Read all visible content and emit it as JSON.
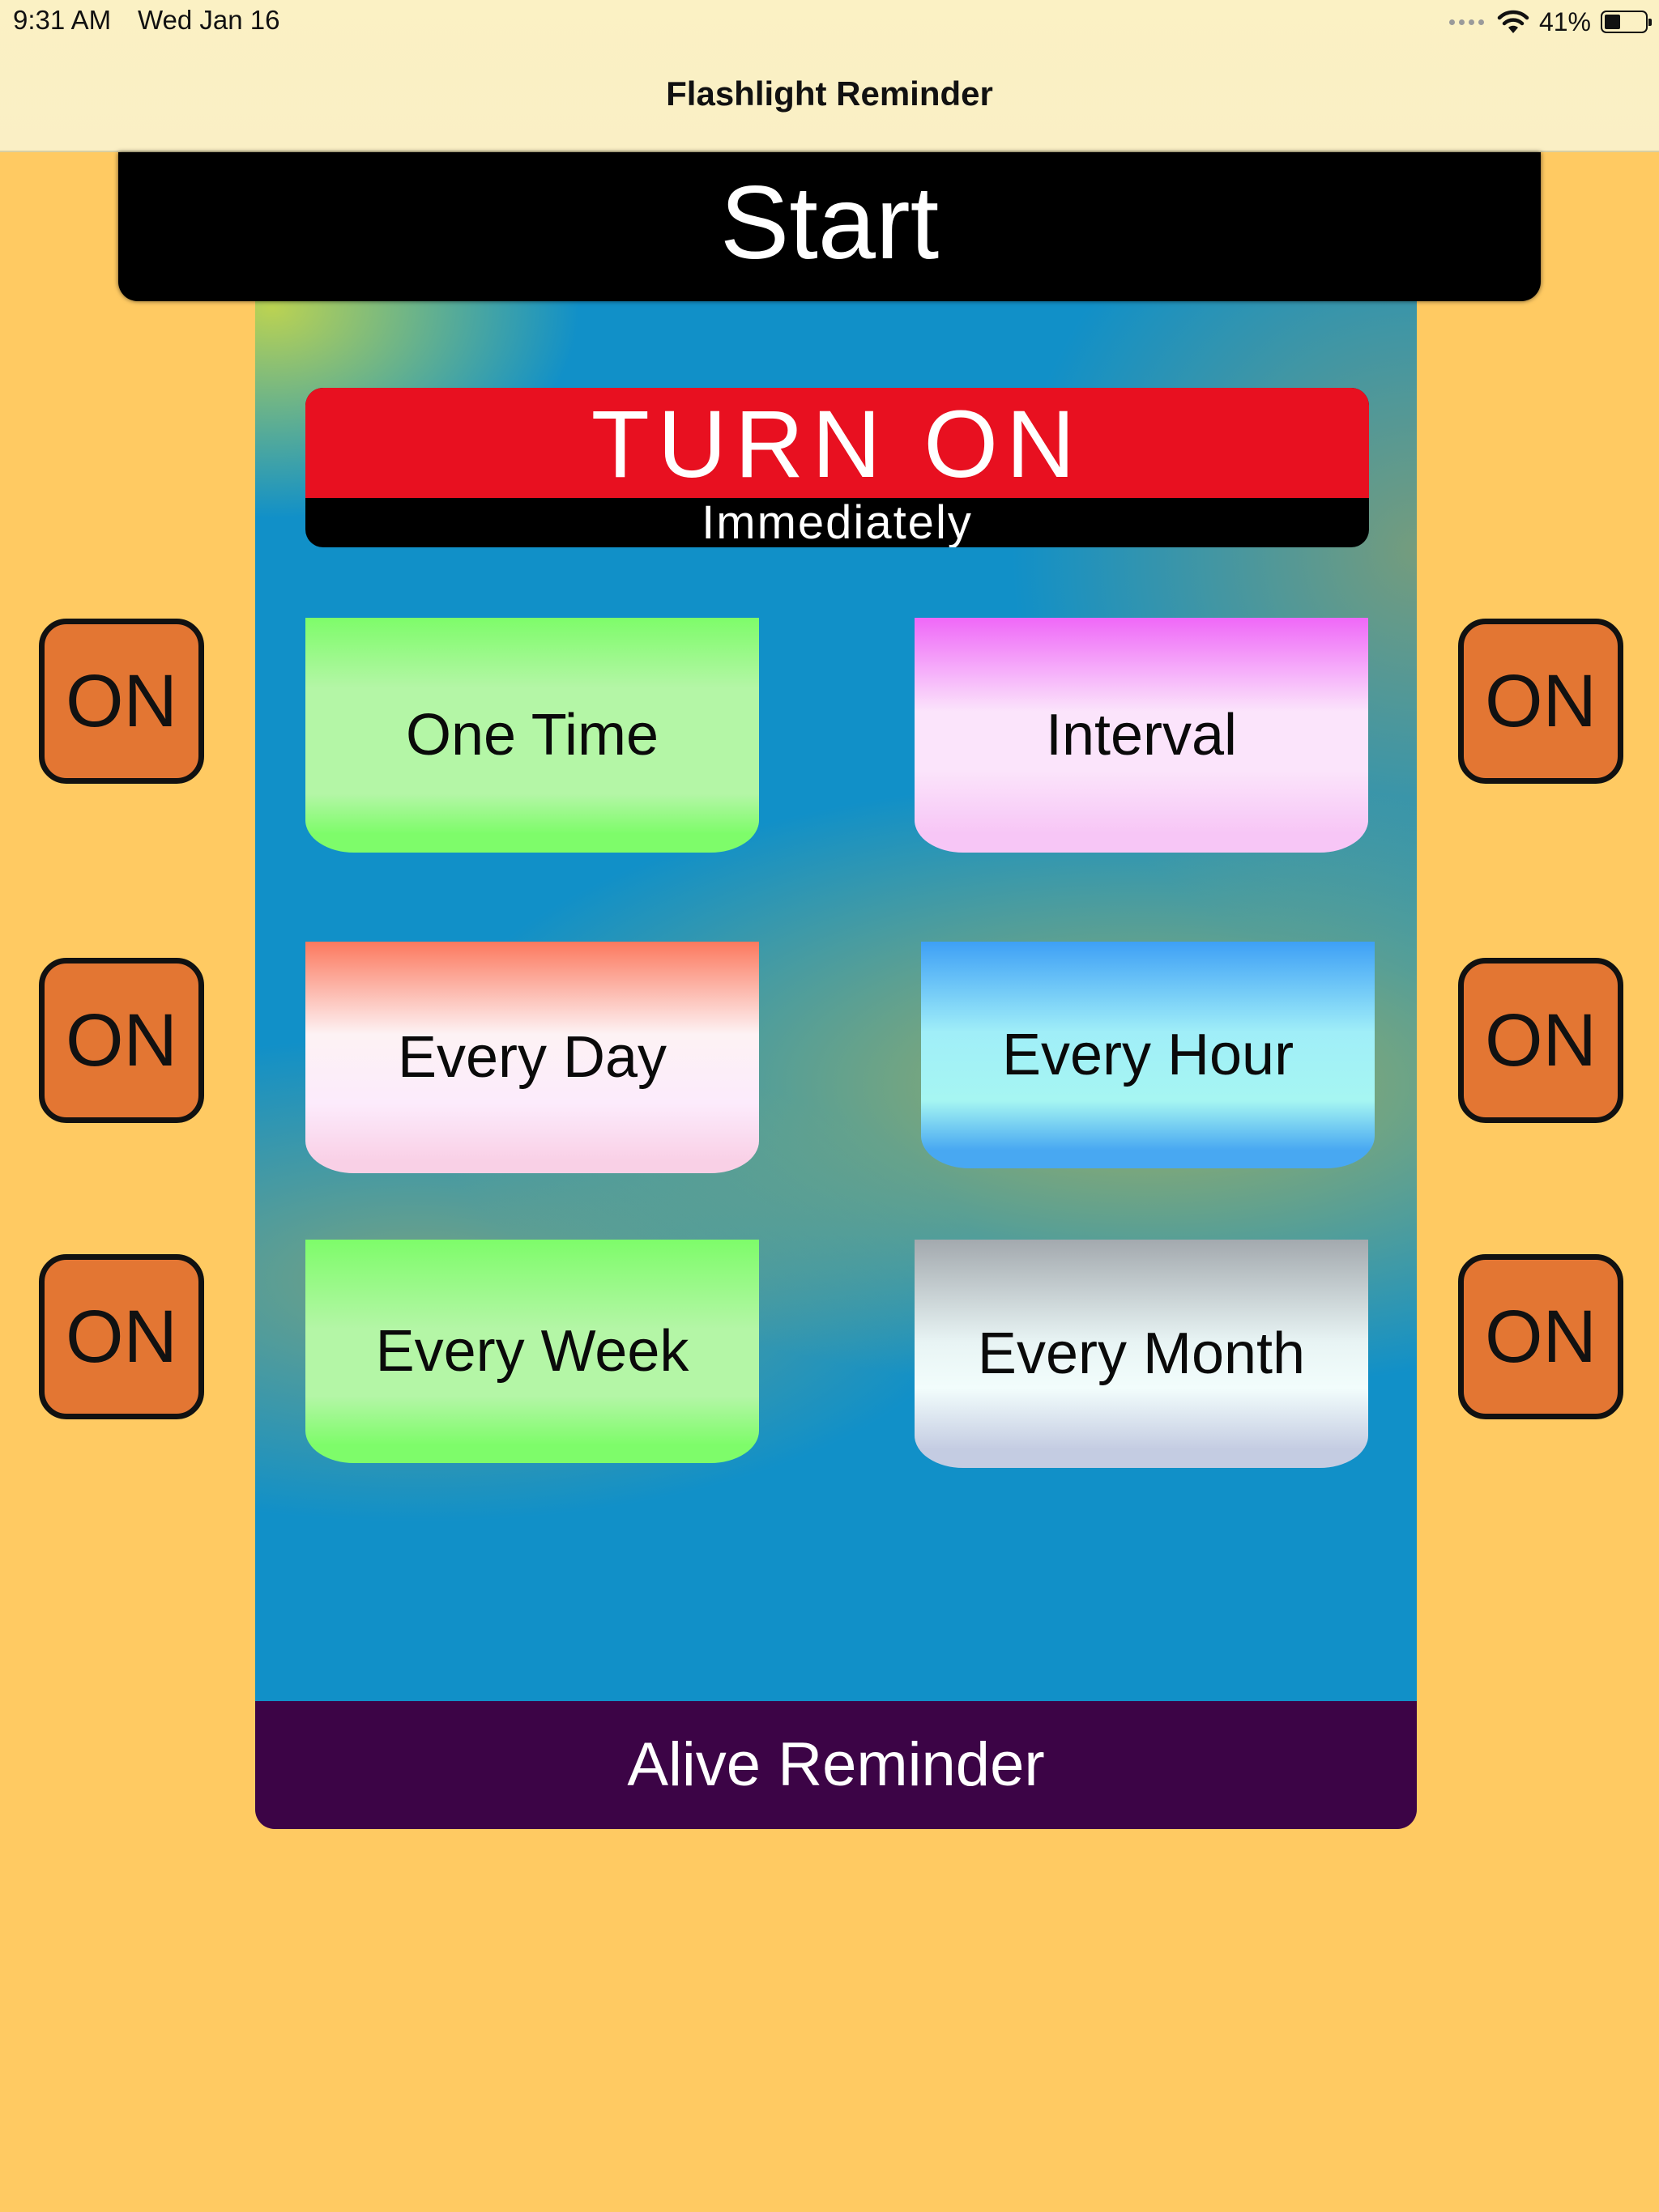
{
  "status_bar": {
    "time": "9:31 AM",
    "date": "Wed Jan 16",
    "battery": "41%",
    "battery_level": 0.41
  },
  "nav": {
    "title": "Flashlight Reminder"
  },
  "start_button": "Start",
  "turn_on": {
    "title": "TURN ON",
    "subtitle": "Immediately"
  },
  "options": {
    "one_time": "One Time",
    "interval": "Interval",
    "every_day": "Every Day",
    "every_hour": "Every Hour",
    "every_week": "Every Week",
    "every_month": "Every Month"
  },
  "toggles": {
    "one_time": "ON",
    "interval": "ON",
    "every_day": "ON",
    "every_hour": "ON",
    "every_week": "ON",
    "every_month": "ON"
  },
  "footer_button": "Alive Reminder",
  "colors": {
    "background": "#ffca62",
    "panel": "#1190c8",
    "start_bar": "#000000",
    "turn_on_red": "#e81020",
    "on_button": "#e37633",
    "footer": "#3c0446"
  }
}
